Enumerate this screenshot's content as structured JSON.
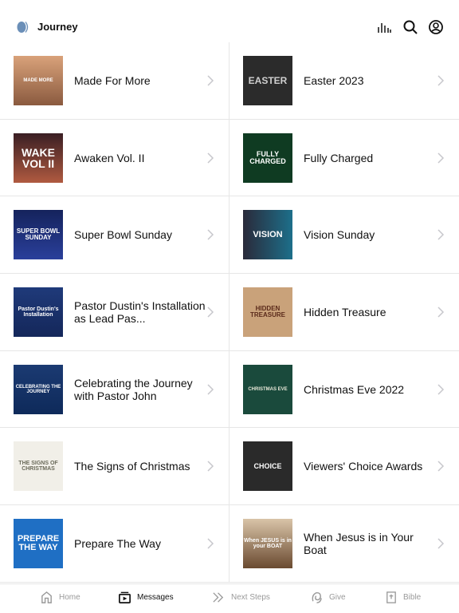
{
  "header": {
    "title": "Journey",
    "icons": [
      "audio-bars-icon",
      "search-icon",
      "account-icon"
    ]
  },
  "colors": {
    "logo": "#6b8fb8",
    "active_tab": "#111111",
    "inactive_tab": "#999999"
  },
  "messages": [
    {
      "title": "Made For More",
      "thumb_text": "MADE MORE",
      "bg": "linear-gradient(#d9a27a,#8a5a3f)",
      "fg": "#fff",
      "fs": 6
    },
    {
      "title": "Easter 2023",
      "thumb_text": "EASTER",
      "bg": "#2b2b2b",
      "fg": "#cfcfcf",
      "fs": 12
    },
    {
      "title": "Awaken Vol. II",
      "thumb_text": "WAKE VOL II",
      "bg": "linear-gradient(#3a1f24,#b05a40)",
      "fg": "#fff",
      "fs": 14
    },
    {
      "title": "Fully Charged",
      "thumb_text": "FULLY CHARGED",
      "bg": "#0f3b22",
      "fg": "#fff",
      "fs": 9
    },
    {
      "title": "Super Bowl Sunday",
      "thumb_text": "SUPER BOWL SUNDAY",
      "bg": "linear-gradient(#15235c,#2a3f9a)",
      "fg": "#fff",
      "fs": 8
    },
    {
      "title": "Vision Sunday",
      "thumb_text": "VISION",
      "bg": "linear-gradient(90deg,#2a2a3a,#1d6f8a)",
      "fg": "#fff",
      "fs": 11
    },
    {
      "title": "Pastor Dustin's Installation as Lead Pas...",
      "thumb_text": "Pastor Dustin's Installation",
      "bg": "linear-gradient(#1f3a7a,#14275a)",
      "fg": "#fff",
      "fs": 7
    },
    {
      "title": "Hidden Treasure",
      "thumb_text": "HIDDEN TREASURE",
      "bg": "#c9a27a",
      "fg": "#5a2a1a",
      "fs": 8
    },
    {
      "title": "Celebrating the Journey with Pastor John",
      "thumb_text": "CELEBRATING THE JOURNEY",
      "bg": "linear-gradient(#1b3a72,#0e2a5a)",
      "fg": "#fff",
      "fs": 6
    },
    {
      "title": "Christmas Eve 2022",
      "thumb_text": "CHRISTMAS EVE",
      "bg": "#1a4a3c",
      "fg": "#e8e8d8",
      "fs": 6
    },
    {
      "title": "The Signs of Christmas",
      "thumb_text": "THE SIGNS OF CHRISTMAS",
      "bg": "#f1efe8",
      "fg": "#6a6a5a",
      "fs": 7
    },
    {
      "title": "Viewers' Choice Awards",
      "thumb_text": "CHOICE",
      "bg": "#2a2a2a",
      "fg": "#fff",
      "fs": 9
    },
    {
      "title": "Prepare The Way",
      "thumb_text": "PREPARE THE WAY",
      "bg": "#1f6fc4",
      "fg": "#fff",
      "fs": 11
    },
    {
      "title": "When Jesus is in Your Boat",
      "thumb_text": "When JESUS is in your BOAT",
      "bg": "linear-gradient(#d9c4a8,#6a4a30)",
      "fg": "#fff",
      "fs": 7
    }
  ],
  "tabs": [
    {
      "label": "Home",
      "icon": "home-icon",
      "active": false
    },
    {
      "label": "Messages",
      "icon": "messages-icon",
      "active": true
    },
    {
      "label": "Next Steps",
      "icon": "double-chevron-icon",
      "active": false
    },
    {
      "label": "Give",
      "icon": "give-icon",
      "active": false
    },
    {
      "label": "Bible",
      "icon": "bible-icon",
      "active": false
    }
  ]
}
